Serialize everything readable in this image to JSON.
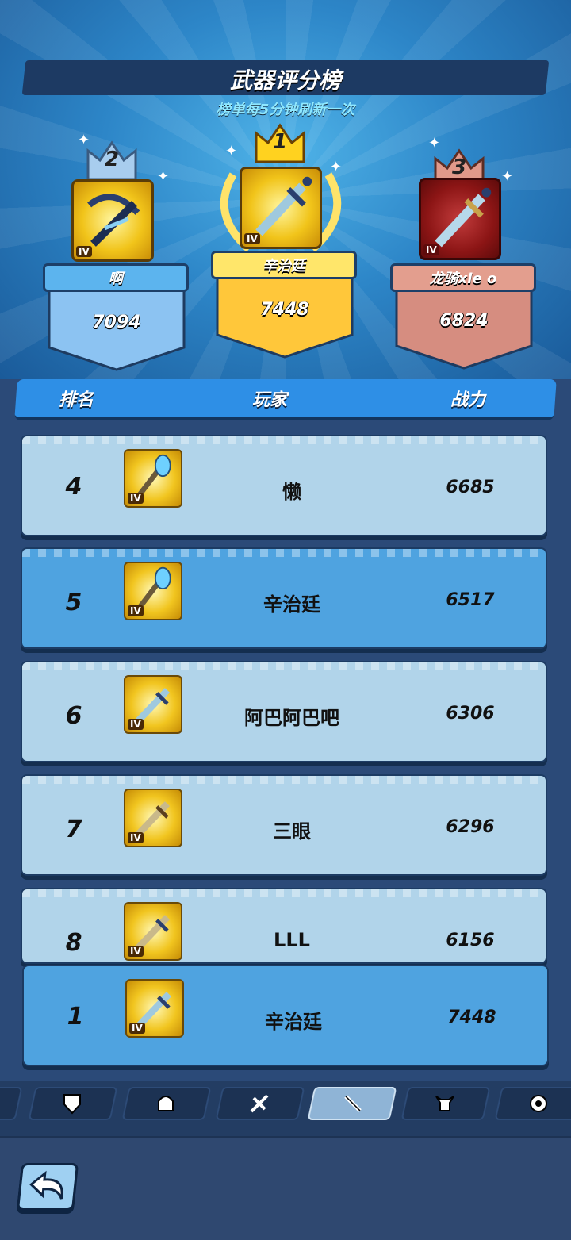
{
  "header": {
    "title": "武器评分榜",
    "subtitle": "榜单每5分钟刷新一次"
  },
  "podium": [
    {
      "rank": "2",
      "name": "啊",
      "score": "7094",
      "tier": "IV",
      "weapon_icon": "crossbow-icon"
    },
    {
      "rank": "1",
      "name": "辛治廷",
      "score": "7448",
      "tier": "IV",
      "weapon_icon": "sword-icon"
    },
    {
      "rank": "3",
      "name": "龙骑xle o",
      "score": "6824",
      "tier": "IV",
      "weapon_icon": "sword-icon"
    }
  ],
  "columns": {
    "rank": "排名",
    "player": "玩家",
    "power": "战力"
  },
  "rows": [
    {
      "rank": "4",
      "name": "懒",
      "score": "6685",
      "tier": "IV",
      "weapon_icon": "staff-icon"
    },
    {
      "rank": "5",
      "name": "辛治廷",
      "score": "6517",
      "tier": "IV",
      "weapon_icon": "staff-icon"
    },
    {
      "rank": "6",
      "name": "阿巴阿巴吧",
      "score": "6306",
      "tier": "IV",
      "weapon_icon": "sword-icon"
    },
    {
      "rank": "7",
      "name": "三眼",
      "score": "6296",
      "tier": "IV",
      "weapon_icon": "sword-icon"
    },
    {
      "rank": "8",
      "name": "LLL",
      "score": "6156",
      "tier": "IV",
      "weapon_icon": "sword-icon"
    }
  ],
  "self_row": {
    "rank": "1",
    "name": "辛治廷",
    "score": "7448",
    "tier": "IV",
    "weapon_icon": "sword-icon"
  },
  "tabs": [
    "shield-icon",
    "helmet-icon",
    "ring-icon",
    "sword-icon",
    "horned-helmet-icon",
    "amulet-icon"
  ],
  "active_tab": "sword-icon",
  "colors": {
    "gold": "#f1c41a",
    "silver_blue": "#8cc3f2",
    "bronze": "#d68d80",
    "row_light": "#b1d4ea",
    "row_dark": "#4fa3e0"
  }
}
